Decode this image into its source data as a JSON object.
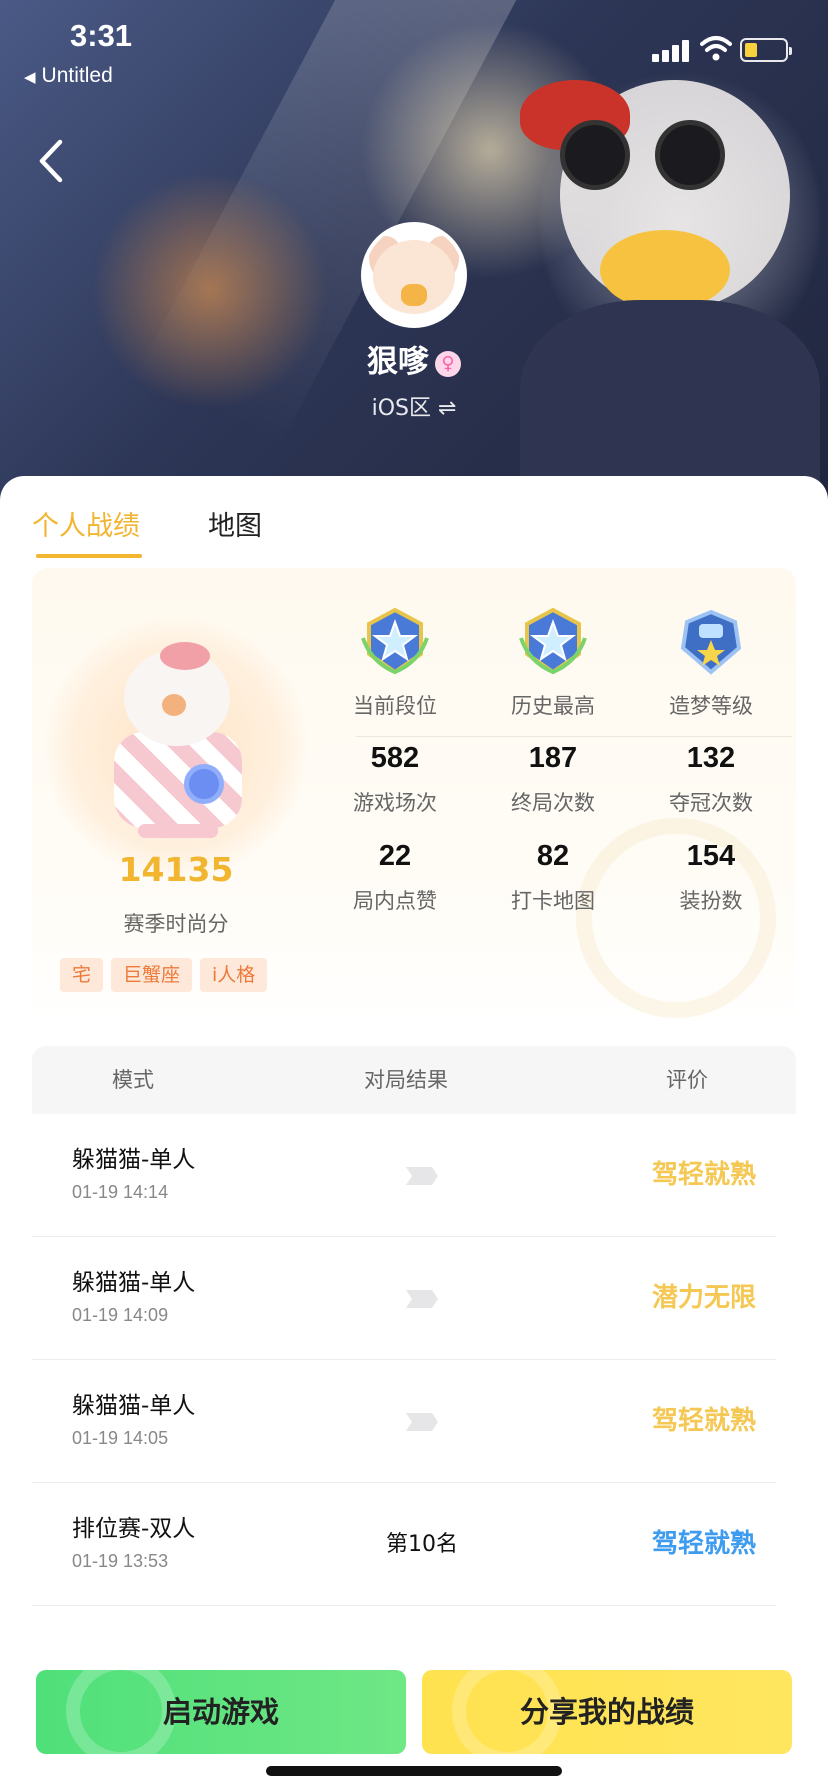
{
  "status_bar": {
    "time": "3:31",
    "back_app": "Untitled"
  },
  "profile": {
    "username": "狠嗲",
    "gender_symbol": "♀",
    "region": "iOS区 ⇌"
  },
  "tabs": [
    {
      "label": "个人战绩",
      "active": true
    },
    {
      "label": "地图",
      "active": false
    }
  ],
  "summary": {
    "season_score": "14135",
    "season_score_label": "赛季时尚分",
    "tags": [
      "宅",
      "巨蟹座",
      "i人格"
    ],
    "ranks": [
      {
        "label": "当前段位",
        "icon": "star-rank-badge-icon"
      },
      {
        "label": "历史最高",
        "icon": "star-rank-badge-icon"
      },
      {
        "label": "造梦等级",
        "icon": "dream-level-badge-icon"
      }
    ],
    "metrics": [
      {
        "value": "582",
        "label": "游戏场次"
      },
      {
        "value": "187",
        "label": "终局次数"
      },
      {
        "value": "132",
        "label": "夺冠次数"
      },
      {
        "value": "22",
        "label": "局内点赞"
      },
      {
        "value": "82",
        "label": "打卡地图"
      },
      {
        "value": "154",
        "label": "装扮数"
      }
    ]
  },
  "records": {
    "headers": {
      "mode": "模式",
      "result": "对局结果",
      "rating": "评价"
    },
    "rows": [
      {
        "mode": "躲猫猫-单人",
        "datetime": "01-19 14:14",
        "result": "",
        "result_icon": "flag-icon",
        "rating": "驾轻就熟",
        "rating_color": "#f5c753"
      },
      {
        "mode": "躲猫猫-单人",
        "datetime": "01-19 14:09",
        "result": "",
        "result_icon": "flag-icon",
        "rating": "潜力无限",
        "rating_color": "#f5c753"
      },
      {
        "mode": "躲猫猫-单人",
        "datetime": "01-19 14:05",
        "result": "",
        "result_icon": "flag-icon",
        "rating": "驾轻就熟",
        "rating_color": "#f5c753"
      },
      {
        "mode": "排位赛-双人",
        "datetime": "01-19 13:53",
        "result": "第10名",
        "result_icon": "",
        "rating": "驾轻就熟",
        "rating_color": "#3d9bf0"
      }
    ]
  },
  "buttons": {
    "start_game": "启动游戏",
    "share": "分享我的战绩"
  },
  "colors": {
    "accent": "#f2b530",
    "start_green": "#5ce27e",
    "share_yellow": "#ffe258",
    "blue_rating": "#3d9bf0"
  }
}
